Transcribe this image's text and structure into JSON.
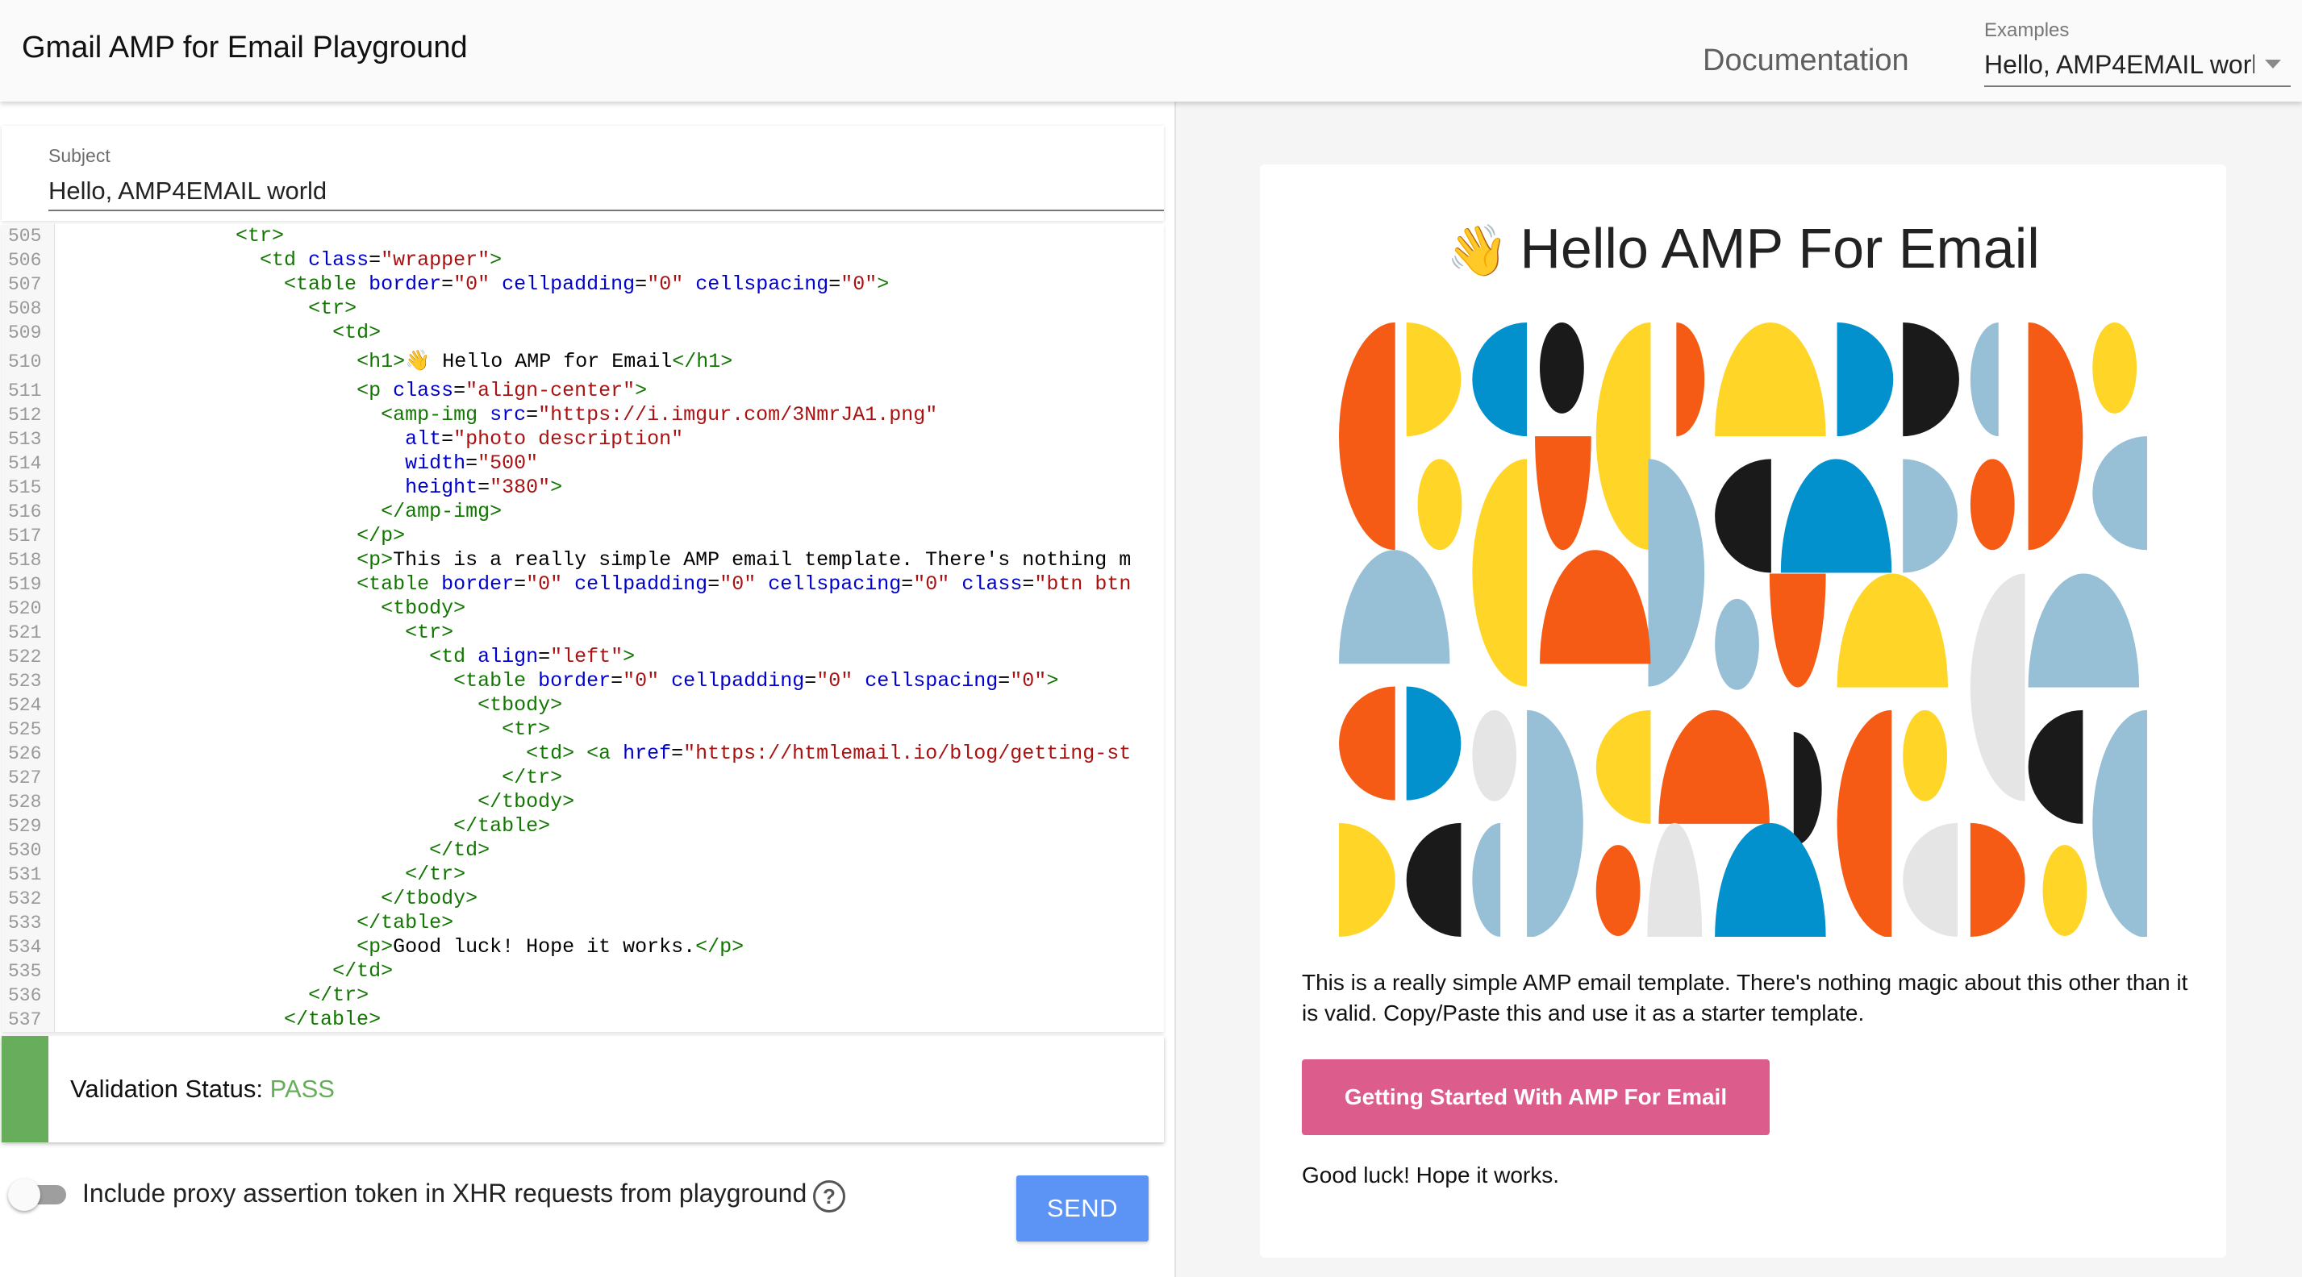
{
  "header": {
    "title": "Gmail AMP for Email Playground",
    "documentation_link": "Documentation",
    "examples": {
      "label": "Examples",
      "selected": "Hello, AMP4EMAIL worl",
      "icon": "caret-down-icon"
    }
  },
  "subject": {
    "label": "Subject",
    "value": "Hello, AMP4EMAIL world"
  },
  "editor": {
    "lines": [
      {
        "n": "505",
        "indent": 14,
        "parts": [
          [
            "t",
            "<tr>"
          ]
        ]
      },
      {
        "n": "506",
        "indent": 16,
        "parts": [
          [
            "t",
            "<td "
          ],
          [
            "a",
            "class"
          ],
          [
            "x",
            "="
          ],
          [
            "s",
            "\"wrapper\""
          ],
          [
            "t",
            ">"
          ]
        ]
      },
      {
        "n": "507",
        "indent": 18,
        "parts": [
          [
            "t",
            "<table "
          ],
          [
            "a",
            "border"
          ],
          [
            "x",
            "="
          ],
          [
            "s",
            "\"0\""
          ],
          [
            "x",
            " "
          ],
          [
            "a",
            "cellpadding"
          ],
          [
            "x",
            "="
          ],
          [
            "s",
            "\"0\""
          ],
          [
            "x",
            " "
          ],
          [
            "a",
            "cellspacing"
          ],
          [
            "x",
            "="
          ],
          [
            "s",
            "\"0\""
          ],
          [
            "t",
            ">"
          ]
        ]
      },
      {
        "n": "508",
        "indent": 20,
        "parts": [
          [
            "t",
            "<tr>"
          ]
        ]
      },
      {
        "n": "509",
        "indent": 22,
        "parts": [
          [
            "t",
            "<td>"
          ]
        ]
      },
      {
        "n": "510",
        "indent": 24,
        "tall": true,
        "parts": [
          [
            "t",
            "<h1>"
          ],
          [
            "x",
            "👋 Hello AMP for Email"
          ],
          [
            "t",
            "</h1>"
          ]
        ]
      },
      {
        "n": "511",
        "indent": 24,
        "parts": [
          [
            "t",
            "<p "
          ],
          [
            "a",
            "class"
          ],
          [
            "x",
            "="
          ],
          [
            "s",
            "\"align-center\""
          ],
          [
            "t",
            ">"
          ]
        ]
      },
      {
        "n": "512",
        "indent": 26,
        "parts": [
          [
            "t",
            "<amp-img "
          ],
          [
            "a",
            "src"
          ],
          [
            "x",
            "="
          ],
          [
            "s",
            "\"https://i.imgur.com/3NmrJA1.png\""
          ]
        ]
      },
      {
        "n": "513",
        "indent": 28,
        "parts": [
          [
            "a",
            "alt"
          ],
          [
            "x",
            "="
          ],
          [
            "s",
            "\"photo description\""
          ]
        ]
      },
      {
        "n": "514",
        "indent": 28,
        "parts": [
          [
            "a",
            "width"
          ],
          [
            "x",
            "="
          ],
          [
            "s",
            "\"500\""
          ]
        ]
      },
      {
        "n": "515",
        "indent": 28,
        "parts": [
          [
            "a",
            "height"
          ],
          [
            "x",
            "="
          ],
          [
            "s",
            "\"380\""
          ],
          [
            "t",
            ">"
          ]
        ]
      },
      {
        "n": "516",
        "indent": 26,
        "parts": [
          [
            "t",
            "</amp-img>"
          ]
        ]
      },
      {
        "n": "517",
        "indent": 24,
        "parts": [
          [
            "t",
            "</p>"
          ]
        ]
      },
      {
        "n": "518",
        "indent": 24,
        "parts": [
          [
            "t",
            "<p>"
          ],
          [
            "x",
            "This is a really simple AMP email template. There's nothing m"
          ]
        ]
      },
      {
        "n": "519",
        "indent": 24,
        "parts": [
          [
            "t",
            "<table "
          ],
          [
            "a",
            "border"
          ],
          [
            "x",
            "="
          ],
          [
            "s",
            "\"0\""
          ],
          [
            "x",
            " "
          ],
          [
            "a",
            "cellpadding"
          ],
          [
            "x",
            "="
          ],
          [
            "s",
            "\"0\""
          ],
          [
            "x",
            " "
          ],
          [
            "a",
            "cellspacing"
          ],
          [
            "x",
            "="
          ],
          [
            "s",
            "\"0\""
          ],
          [
            "x",
            " "
          ],
          [
            "a",
            "class"
          ],
          [
            "x",
            "="
          ],
          [
            "s",
            "\"btn btn"
          ]
        ]
      },
      {
        "n": "520",
        "indent": 26,
        "parts": [
          [
            "t",
            "<tbody>"
          ]
        ]
      },
      {
        "n": "521",
        "indent": 28,
        "parts": [
          [
            "t",
            "<tr>"
          ]
        ]
      },
      {
        "n": "522",
        "indent": 30,
        "parts": [
          [
            "t",
            "<td "
          ],
          [
            "a",
            "align"
          ],
          [
            "x",
            "="
          ],
          [
            "s",
            "\"left\""
          ],
          [
            "t",
            ">"
          ]
        ]
      },
      {
        "n": "523",
        "indent": 32,
        "parts": [
          [
            "t",
            "<table "
          ],
          [
            "a",
            "border"
          ],
          [
            "x",
            "="
          ],
          [
            "s",
            "\"0\""
          ],
          [
            "x",
            " "
          ],
          [
            "a",
            "cellpadding"
          ],
          [
            "x",
            "="
          ],
          [
            "s",
            "\"0\""
          ],
          [
            "x",
            " "
          ],
          [
            "a",
            "cellspacing"
          ],
          [
            "x",
            "="
          ],
          [
            "s",
            "\"0\""
          ],
          [
            "t",
            ">"
          ]
        ]
      },
      {
        "n": "524",
        "indent": 34,
        "parts": [
          [
            "t",
            "<tbody>"
          ]
        ]
      },
      {
        "n": "525",
        "indent": 36,
        "parts": [
          [
            "t",
            "<tr>"
          ]
        ]
      },
      {
        "n": "526",
        "indent": 38,
        "parts": [
          [
            "t",
            "<td> <a "
          ],
          [
            "a",
            "href"
          ],
          [
            "x",
            "="
          ],
          [
            "s",
            "\"https://htmlemail.io/blog/getting-st"
          ]
        ]
      },
      {
        "n": "527",
        "indent": 36,
        "parts": [
          [
            "t",
            "</tr>"
          ]
        ]
      },
      {
        "n": "528",
        "indent": 34,
        "parts": [
          [
            "t",
            "</tbody>"
          ]
        ]
      },
      {
        "n": "529",
        "indent": 32,
        "parts": [
          [
            "t",
            "</table>"
          ]
        ]
      },
      {
        "n": "530",
        "indent": 30,
        "parts": [
          [
            "t",
            "</td>"
          ]
        ]
      },
      {
        "n": "531",
        "indent": 28,
        "parts": [
          [
            "t",
            "</tr>"
          ]
        ]
      },
      {
        "n": "532",
        "indent": 26,
        "parts": [
          [
            "t",
            "</tbody>"
          ]
        ]
      },
      {
        "n": "533",
        "indent": 24,
        "parts": [
          [
            "t",
            "</table>"
          ]
        ]
      },
      {
        "n": "534",
        "indent": 24,
        "parts": [
          [
            "t",
            "<p>"
          ],
          [
            "x",
            "Good luck! Hope it works."
          ],
          [
            "t",
            "</p>"
          ]
        ]
      },
      {
        "n": "535",
        "indent": 22,
        "parts": [
          [
            "t",
            "</td>"
          ]
        ]
      },
      {
        "n": "536",
        "indent": 20,
        "parts": [
          [
            "t",
            "</tr>"
          ]
        ]
      },
      {
        "n": "537",
        "indent": 18,
        "parts": [
          [
            "t",
            "</table>"
          ]
        ]
      }
    ]
  },
  "validation": {
    "label": "Validation Status: ",
    "status": "PASS",
    "status_color": "#67ad5b"
  },
  "controls": {
    "proxy_toggle_label": "Include proxy assertion token in XHR requests from playground",
    "proxy_toggle_on": false,
    "help_icon": "?",
    "send_label": "SEND"
  },
  "preview": {
    "heading_emoji": "👋",
    "heading": "Hello AMP For Email",
    "image_alt": "photo description",
    "paragraph": "This is a really simple AMP email template. There's nothing magic about this other than it is valid. Copy/Paste this and use it as a starter template.",
    "cta_label": "Getting Started With AMP For Email",
    "cta_color": "#dc5c8c",
    "closing": "Good luck! Hope it works."
  }
}
